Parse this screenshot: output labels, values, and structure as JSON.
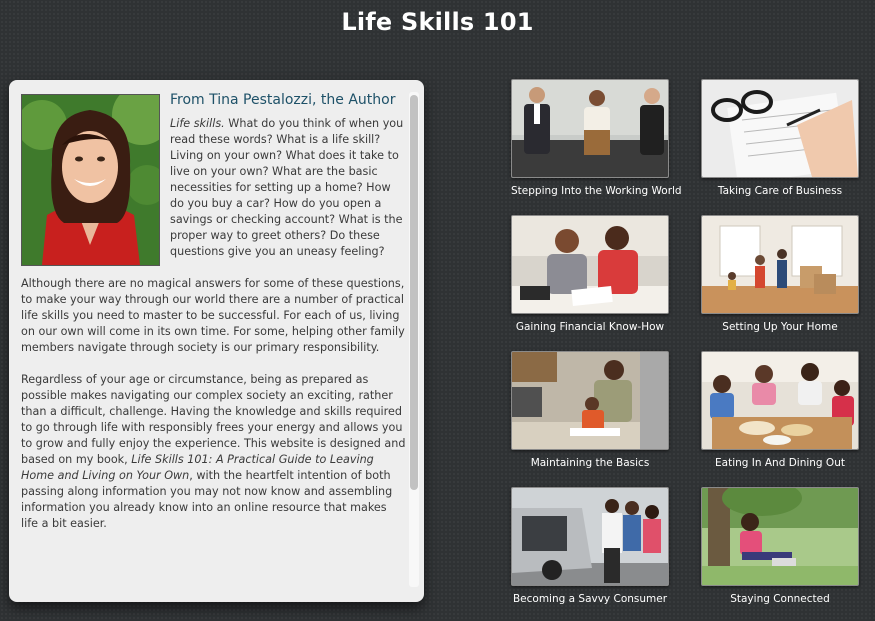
{
  "page": {
    "title": "Life Skills 101"
  },
  "author": {
    "heading": "From Tina Pestalozzi, the Author",
    "p1_italic": "Life skills.",
    "p1_rest": " What do you think of when you read these words? What is a life skill? Living on your own? What does it take to live on your own? What are the basic necessities for setting up a home? How do you buy a car? How do you open a savings or checking account? What is the proper way to greet others? Do these questions give you an uneasy feeling?",
    "p2": "Although there are no magical answers for some of these questions, to make your way through our world there are a number of practical life skills you need to master to be successful. For each of us, living on our own will come in its own time. For some, helping other family members navigate through society is our primary responsibility.",
    "p3_a": "Regardless of your age or circumstance, being as prepared as possible makes navigating our complex society an exciting, rather than a difficult, challenge. Having the knowledge and skills required to go through life with responsibly frees your energy and allows you to grow and fully enjoy the experience. This website is designed and based on my book, ",
    "p3_book": "Life Skills 101: A Practical Guide to Leaving Home and Living on Your Own",
    "p3_b": ", with the heartfelt intention of both passing along information you may not now know and assembling information you already know into an online resource that makes life a bit easier."
  },
  "tiles": [
    {
      "caption": "Stepping Into the Working World"
    },
    {
      "caption": "Taking Care of Business"
    },
    {
      "caption": "Gaining Financial Know-How"
    },
    {
      "caption": "Setting Up Your Home"
    },
    {
      "caption": "Maintaining the Basics"
    },
    {
      "caption": "Eating In And Dining Out"
    },
    {
      "caption": "Becoming a Savvy Consumer"
    },
    {
      "caption": "Staying Connected"
    }
  ]
}
